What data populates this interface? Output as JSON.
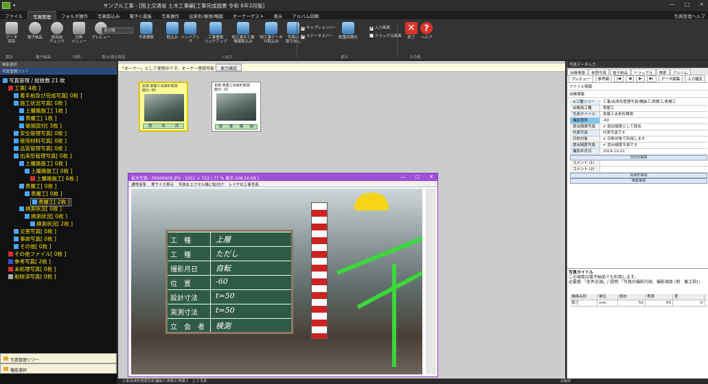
{
  "titlebar": {
    "title": "サンプル工事 - [国土交通省 土木工事編[工事完成図書 令和 6年3月版]",
    "quick_access": "▾",
    "minimize": "—",
    "maximize": "□",
    "close": "✕"
  },
  "menu": {
    "tabs": [
      "ファイル",
      "写真管理",
      "フォルダ操作",
      "写真取込み",
      "電子小黒板",
      "写真操作",
      "出来形/検測/略図",
      "オーナーゲスト",
      "表示",
      "アルバム印刷"
    ],
    "active_index": 1,
    "help_label": "写真管理ヘルプ"
  },
  "ribbon": {
    "buttons": {
      "save": "データ\n保存",
      "e_nouhin": "電子納品",
      "check": "提出前\nチェック",
      "print_menu": "印刷\nメニュー",
      "preview": "プレビュー",
      "photo_search": "写真検索",
      "import": "取込み",
      "backup": "バックアップ",
      "eng_backup": "工事情報\nバックアップ",
      "eng_import": "他工事の工事\n情報取込み",
      "other_import": "他工事データ\nの取込み",
      "recall": "写真の\n取り出し",
      "layout_reset": "配置初期化",
      "exit": "終了",
      "help": "ヘルプ"
    },
    "select_value": "並び順",
    "groups": [
      "保存",
      "電子納品",
      "印刷",
      "表示/表示設定",
      "入出力",
      "表示",
      "その他"
    ],
    "checks": [
      {
        "label": "キャプションバー",
        "checked": true
      },
      {
        "label": "ステータスバー",
        "checked": true
      },
      {
        "label": "入力画面",
        "checked": true
      },
      {
        "label": "ドラッグ元画面",
        "checked": false
      }
    ]
  },
  "left_panel": {
    "header": "機能選択",
    "subheader": "写真管理ツリー",
    "tree": [
      {
        "label": "写真管理 / 総枚数 21 枚",
        "level": 0,
        "color": "#4aa8ff",
        "root": true
      },
      {
        "label": "工事[ 4枚 ]",
        "level": 1,
        "color": "#d43030"
      },
      {
        "label": "着手前及び完成写真[ 0枚 ]",
        "level": 2,
        "color": "#4aa8ff"
      },
      {
        "label": "施工状況写真[ 0枚 ]",
        "level": 2,
        "color": "#4aa8ff"
      },
      {
        "label": "上層路盤工[ 1枚 ]",
        "level": 3,
        "color": "#4aa8ff"
      },
      {
        "label": "表層工[ 1枚 ]",
        "level": 3,
        "color": "#4aa8ff"
      },
      {
        "label": "破損部分[ 3枚 ]",
        "level": 3,
        "color": "#4aa8ff"
      },
      {
        "label": "安全管理写真[ 0枚 ]",
        "level": 2,
        "color": "#4aa8ff"
      },
      {
        "label": "使用材料写真[ 0枚 ]",
        "level": 2,
        "color": "#4aa8ff"
      },
      {
        "label": "品質管理写真[ 0枚 ]",
        "level": 2,
        "color": "#4aa8ff"
      },
      {
        "label": "出来形管理写真[ 0枚 ]",
        "level": 2,
        "color": "#4aa8ff"
      },
      {
        "label": "上層路盤工[ 0枚 ]",
        "level": 3,
        "color": "#4aa8ff"
      },
      {
        "label": "上層路盤工[ 0枚 ]",
        "level": 4,
        "color": "#4aa8ff"
      },
      {
        "label": "上層路盤工[ 6枚 ]",
        "level": 5,
        "color": "#d43030"
      },
      {
        "label": "表層工[ 0枚 ]",
        "level": 3,
        "color": "#4aa8ff"
      },
      {
        "label": "表層工[ 0枚 ]",
        "level": 4,
        "color": "#4aa8ff"
      },
      {
        "label": "表層工[ 2枚 ]",
        "level": 5,
        "color": "#4aa8ff",
        "selected": true
      },
      {
        "label": "検測状況[ 0枚 ]",
        "level": 3,
        "color": "#4aa8ff"
      },
      {
        "label": "検測状況[ 0枚 ]",
        "level": 4,
        "color": "#4aa8ff"
      },
      {
        "label": "検測状況[ 2枚 ]",
        "level": 5,
        "color": "#4aa8ff"
      },
      {
        "label": "災害写真[ 0枚 ]",
        "level": 2,
        "color": "#4aa8ff"
      },
      {
        "label": "事故写真[ 0枚 ]",
        "level": 2,
        "color": "#4aa8ff"
      },
      {
        "label": "その他[ 0枚 ]",
        "level": 2,
        "color": "#4aa8ff"
      },
      {
        "label": "その他ファイル[ 0枚 ]",
        "level": 1,
        "color": "#d43030"
      },
      {
        "label": "参考写真[ 2枚 ]",
        "level": 1,
        "color": "#3050d0"
      },
      {
        "label": "未処理写真[ 0枚 ]",
        "level": 1,
        "color": "#d43030"
      },
      {
        "label": "削除済写真[ 0枚 ]",
        "level": 1,
        "color": "#aaaaaa"
      }
    ],
    "bottom_tabs": [
      "写真管理ツリー",
      "機能選択"
    ]
  },
  "center": {
    "infobar_text": "「オーナー」として使用中です。オーナー登録可能です",
    "infobar_button": "表示確認",
    "thumbs": [
      {
        "caption": "名称:表層工出来形検測\n面元:-60",
        "footer": [
          "提",
          "出",
          "済"
        ],
        "highlighted": true
      },
      {
        "caption": "名称:表層工出来形検測\n面元:-20",
        "footer": [
          "提",
          "参",
          "格",
          "納"
        ],
        "highlighted": false
      }
    ]
  },
  "viewer": {
    "title": "拡大写真 - P0000008.JPG - 1051 × 733 ( 77 % 表示 508,50 KB )",
    "menu": [
      "通常倍率",
      "実サイズ表示",
      "写真をエクセル帳に貼付け",
      "レイヤ化工事写真"
    ],
    "board_labels": [
      "工　種",
      "工　種",
      "撮影月日",
      "位　置",
      "設計寸法",
      "実測寸法",
      "立　会　者"
    ],
    "board_values": [
      "上層",
      "ただし",
      "自転",
      "-60",
      "t=50",
      "t=50",
      "検測"
    ]
  },
  "right_panel": {
    "header": "写真データ入力",
    "tabs": [
      "台帳情報",
      "参照写真",
      "電子納品",
      "ドラッグ元",
      "検索",
      "アルバム"
    ],
    "tools": [
      "プレビュー",
      "参考図",
      "|◀",
      "◀",
      "▶",
      "▶|",
      "データ編集",
      "入力確定"
    ],
    "sections": [
      "ファイル情報",
      "台帳情報"
    ],
    "props": [
      {
        "key": "※工種ツリー",
        "value": "工事/出来形管理写真/舗装工/表層工/表層工",
        "style": "blue"
      },
      {
        "key": "台帳用工種",
        "value": "表層工",
        "style": ""
      },
      {
        "key": "写真タイトル",
        "value": "表層工出来形検測",
        "style": "blue"
      },
      {
        "key": "撮影箇所",
        "value": "-60",
        "style": "hilite"
      },
      {
        "key": "提出頻度写真",
        "value": "✔ 提出頻度として提出",
        "style": ""
      },
      {
        "key": "代表写真",
        "value": "代表写真です",
        "style": "blue"
      },
      {
        "key": "印刷対象",
        "value": "✔ 印刷対象で利用します",
        "style": ""
      },
      {
        "key": "提出頻度写真",
        "value": "✔ 提出頻度写真です",
        "style": "blue"
      },
      {
        "key": "撮影年月日",
        "value": "2014-10-01",
        "style": "blue"
      }
    ],
    "btn_date": "日付の取得",
    "comments": [
      {
        "key": "コメント (1)",
        "value": ""
      },
      {
        "key": "コメント (2)",
        "value": ""
      }
    ],
    "btn_dekigata": "出来形事項",
    "btn_kensoku": "検測事項",
    "desc_title": "写真タイトル",
    "desc_text": "この項目は電子納品でも利用します。\n必要度:「条件必須」/ 説明:「写真の撮影内容、撮影項目 (例　着工前)」",
    "measure": {
      "headers": [
        "規格名称",
        "単位",
        "設計",
        "実測",
        "差"
      ],
      "row": [
        "厚さ",
        "mm",
        "50",
        "50",
        "0"
      ]
    }
  },
  "statusbar": {
    "text": "工事/出来形管理写真/舗装工/表層工/表層工　上 2 写真",
    "right": "台帳用"
  }
}
